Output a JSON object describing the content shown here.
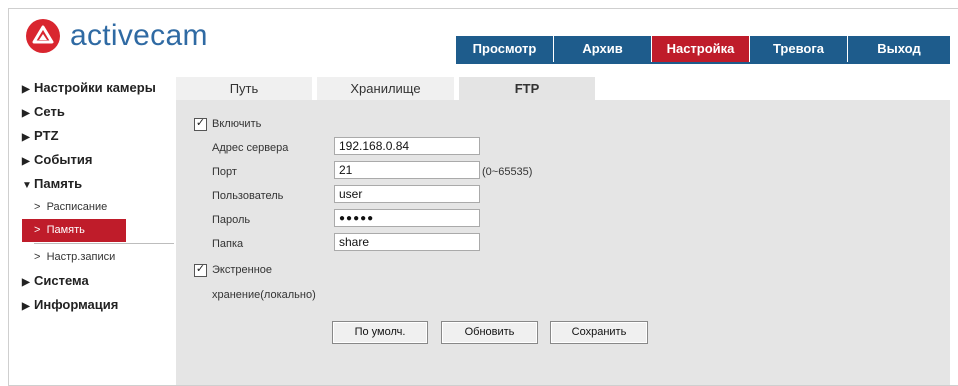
{
  "brand": {
    "name": "activecam",
    "accent": "#d9262f",
    "text_color": "#2f6aa3"
  },
  "nav": {
    "tabs": [
      {
        "label": "Просмотр",
        "active": false
      },
      {
        "label": "Архив",
        "active": false
      },
      {
        "label": "Настройка",
        "active": true
      },
      {
        "label": "Тревога",
        "active": false
      },
      {
        "label": "Выход",
        "active": false
      }
    ],
    "color_default": "#1e5c8c",
    "color_active": "#bf1c2a"
  },
  "sidebar": {
    "items": [
      {
        "label": "Настройки камеры",
        "expanded": false
      },
      {
        "label": "Сеть",
        "expanded": false
      },
      {
        "label": "PTZ",
        "expanded": false
      },
      {
        "label": "События",
        "expanded": false
      },
      {
        "label": "Память",
        "expanded": true
      },
      {
        "label": "Система",
        "expanded": false
      },
      {
        "label": "Информация",
        "expanded": false
      }
    ],
    "memory_subitems": [
      {
        "label": "Расписание",
        "active": false
      },
      {
        "label": "Память",
        "active": true
      },
      {
        "label": "Настр.записи",
        "active": false
      }
    ],
    "bullet": ">"
  },
  "subtabs": [
    {
      "label": "Путь",
      "active": false
    },
    {
      "label": "Хранилище",
      "active": false
    },
    {
      "label": "FTP",
      "active": true
    }
  ],
  "ftp": {
    "enable": {
      "label": "Включить",
      "checked": true
    },
    "server": {
      "label": "Адрес сервера",
      "value": "192.168.0.84"
    },
    "port": {
      "label": "Порт",
      "value": "21",
      "hint": "(0~65535)"
    },
    "user": {
      "label": "Пользователь",
      "value": "user"
    },
    "password": {
      "label": "Пароль",
      "masked": "●●●●●"
    },
    "folder": {
      "label": "Папка",
      "value": "share"
    },
    "emergency": {
      "label_line1": "Экстренное",
      "label_line2": "хранение(локально)",
      "checked": true
    }
  },
  "buttons": {
    "default": "По умолч.",
    "refresh": "Обновить",
    "save": "Сохранить"
  }
}
